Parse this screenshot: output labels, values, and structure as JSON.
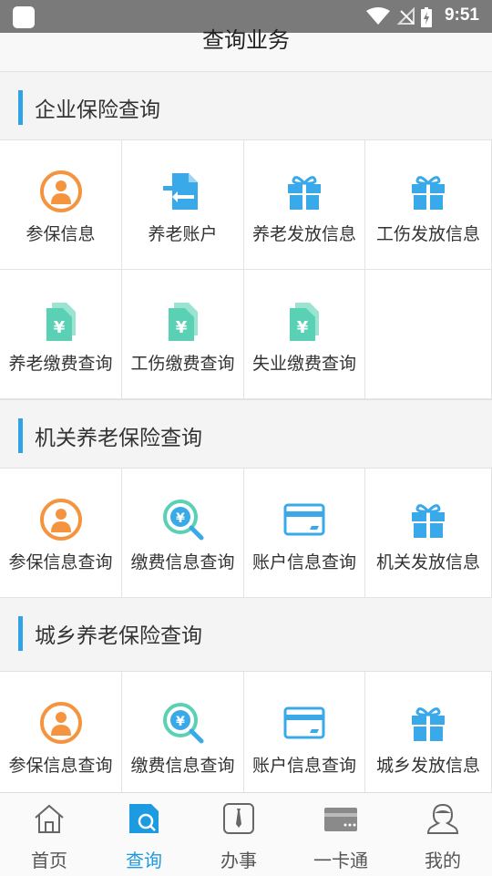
{
  "status_bar": {
    "time": "9:51"
  },
  "header": {
    "title": "查询业务"
  },
  "colors": {
    "accent": "#1d9be0",
    "orange": "#f5943f",
    "blue": "#39a9ea",
    "teal": "#5ad1b4"
  },
  "sections": [
    {
      "title": "企业保险查询",
      "items": [
        {
          "label": "参保信息",
          "icon": "person-circle-icon"
        },
        {
          "label": "养老账户",
          "icon": "transfer-document-icon"
        },
        {
          "label": "养老发放信息",
          "icon": "gift-icon"
        },
        {
          "label": "工伤发放信息",
          "icon": "gift-icon"
        },
        {
          "label": "养老缴费查询",
          "icon": "yuan-document-icon"
        },
        {
          "label": "工伤缴费查询",
          "icon": "yuan-document-icon"
        },
        {
          "label": "失业缴费查询",
          "icon": "yuan-document-icon"
        }
      ]
    },
    {
      "title": "机关养老保险查询",
      "items": [
        {
          "label": "参保信息查询",
          "icon": "person-circle-icon"
        },
        {
          "label": "缴费信息查询",
          "icon": "yuan-search-icon"
        },
        {
          "label": "账户信息查询",
          "icon": "card-icon"
        },
        {
          "label": "机关发放信息",
          "icon": "gift-icon"
        }
      ]
    },
    {
      "title": "城乡养老保险查询",
      "items": [
        {
          "label": "参保信息查询",
          "icon": "person-circle-icon"
        },
        {
          "label": "缴费信息查询",
          "icon": "yuan-search-icon"
        },
        {
          "label": "账户信息查询",
          "icon": "card-icon"
        },
        {
          "label": "城乡发放信息",
          "icon": "gift-icon"
        }
      ]
    }
  ],
  "tabbar": {
    "tabs": [
      {
        "label": "首页",
        "icon": "home-icon"
      },
      {
        "label": "查询",
        "icon": "search-document-icon",
        "active": true
      },
      {
        "label": "办事",
        "icon": "tie-icon"
      },
      {
        "label": "一卡通",
        "icon": "card-icon"
      },
      {
        "label": "我的",
        "icon": "user-icon"
      }
    ]
  }
}
